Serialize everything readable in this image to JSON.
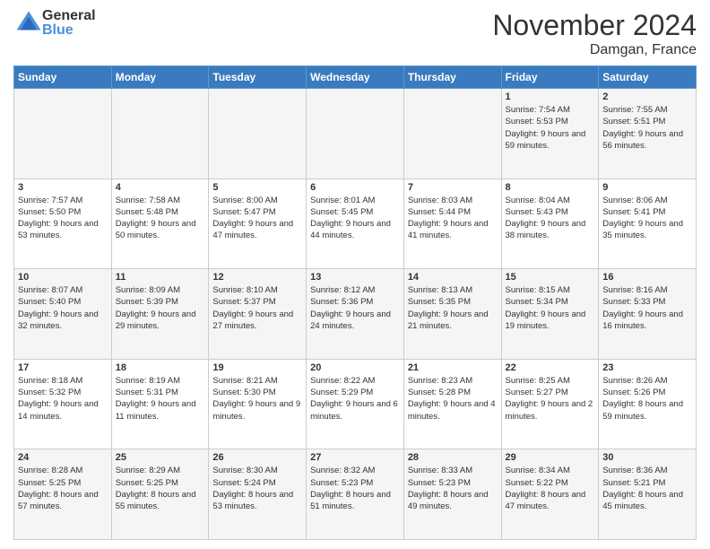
{
  "header": {
    "logo": {
      "general": "General",
      "blue": "Blue"
    },
    "title": "November 2024",
    "location": "Damgan, France"
  },
  "days_of_week": [
    "Sunday",
    "Monday",
    "Tuesday",
    "Wednesday",
    "Thursday",
    "Friday",
    "Saturday"
  ],
  "weeks": [
    [
      {
        "day": "",
        "info": ""
      },
      {
        "day": "",
        "info": ""
      },
      {
        "day": "",
        "info": ""
      },
      {
        "day": "",
        "info": ""
      },
      {
        "day": "",
        "info": ""
      },
      {
        "day": "1",
        "info": "Sunrise: 7:54 AM\nSunset: 5:53 PM\nDaylight: 9 hours and 59 minutes."
      },
      {
        "day": "2",
        "info": "Sunrise: 7:55 AM\nSunset: 5:51 PM\nDaylight: 9 hours and 56 minutes."
      }
    ],
    [
      {
        "day": "3",
        "info": "Sunrise: 7:57 AM\nSunset: 5:50 PM\nDaylight: 9 hours and 53 minutes."
      },
      {
        "day": "4",
        "info": "Sunrise: 7:58 AM\nSunset: 5:48 PM\nDaylight: 9 hours and 50 minutes."
      },
      {
        "day": "5",
        "info": "Sunrise: 8:00 AM\nSunset: 5:47 PM\nDaylight: 9 hours and 47 minutes."
      },
      {
        "day": "6",
        "info": "Sunrise: 8:01 AM\nSunset: 5:45 PM\nDaylight: 9 hours and 44 minutes."
      },
      {
        "day": "7",
        "info": "Sunrise: 8:03 AM\nSunset: 5:44 PM\nDaylight: 9 hours and 41 minutes."
      },
      {
        "day": "8",
        "info": "Sunrise: 8:04 AM\nSunset: 5:43 PM\nDaylight: 9 hours and 38 minutes."
      },
      {
        "day": "9",
        "info": "Sunrise: 8:06 AM\nSunset: 5:41 PM\nDaylight: 9 hours and 35 minutes."
      }
    ],
    [
      {
        "day": "10",
        "info": "Sunrise: 8:07 AM\nSunset: 5:40 PM\nDaylight: 9 hours and 32 minutes."
      },
      {
        "day": "11",
        "info": "Sunrise: 8:09 AM\nSunset: 5:39 PM\nDaylight: 9 hours and 29 minutes."
      },
      {
        "day": "12",
        "info": "Sunrise: 8:10 AM\nSunset: 5:37 PM\nDaylight: 9 hours and 27 minutes."
      },
      {
        "day": "13",
        "info": "Sunrise: 8:12 AM\nSunset: 5:36 PM\nDaylight: 9 hours and 24 minutes."
      },
      {
        "day": "14",
        "info": "Sunrise: 8:13 AM\nSunset: 5:35 PM\nDaylight: 9 hours and 21 minutes."
      },
      {
        "day": "15",
        "info": "Sunrise: 8:15 AM\nSunset: 5:34 PM\nDaylight: 9 hours and 19 minutes."
      },
      {
        "day": "16",
        "info": "Sunrise: 8:16 AM\nSunset: 5:33 PM\nDaylight: 9 hours and 16 minutes."
      }
    ],
    [
      {
        "day": "17",
        "info": "Sunrise: 8:18 AM\nSunset: 5:32 PM\nDaylight: 9 hours and 14 minutes."
      },
      {
        "day": "18",
        "info": "Sunrise: 8:19 AM\nSunset: 5:31 PM\nDaylight: 9 hours and 11 minutes."
      },
      {
        "day": "19",
        "info": "Sunrise: 8:21 AM\nSunset: 5:30 PM\nDaylight: 9 hours and 9 minutes."
      },
      {
        "day": "20",
        "info": "Sunrise: 8:22 AM\nSunset: 5:29 PM\nDaylight: 9 hours and 6 minutes."
      },
      {
        "day": "21",
        "info": "Sunrise: 8:23 AM\nSunset: 5:28 PM\nDaylight: 9 hours and 4 minutes."
      },
      {
        "day": "22",
        "info": "Sunrise: 8:25 AM\nSunset: 5:27 PM\nDaylight: 9 hours and 2 minutes."
      },
      {
        "day": "23",
        "info": "Sunrise: 8:26 AM\nSunset: 5:26 PM\nDaylight: 8 hours and 59 minutes."
      }
    ],
    [
      {
        "day": "24",
        "info": "Sunrise: 8:28 AM\nSunset: 5:25 PM\nDaylight: 8 hours and 57 minutes."
      },
      {
        "day": "25",
        "info": "Sunrise: 8:29 AM\nSunset: 5:25 PM\nDaylight: 8 hours and 55 minutes."
      },
      {
        "day": "26",
        "info": "Sunrise: 8:30 AM\nSunset: 5:24 PM\nDaylight: 8 hours and 53 minutes."
      },
      {
        "day": "27",
        "info": "Sunrise: 8:32 AM\nSunset: 5:23 PM\nDaylight: 8 hours and 51 minutes."
      },
      {
        "day": "28",
        "info": "Sunrise: 8:33 AM\nSunset: 5:23 PM\nDaylight: 8 hours and 49 minutes."
      },
      {
        "day": "29",
        "info": "Sunrise: 8:34 AM\nSunset: 5:22 PM\nDaylight: 8 hours and 47 minutes."
      },
      {
        "day": "30",
        "info": "Sunrise: 8:36 AM\nSunset: 5:21 PM\nDaylight: 8 hours and 45 minutes."
      }
    ]
  ]
}
